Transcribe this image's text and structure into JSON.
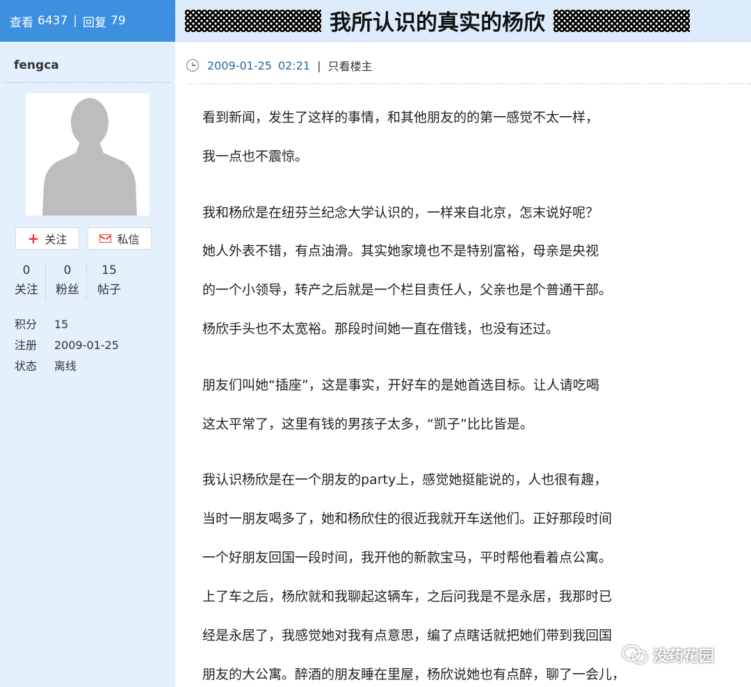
{
  "header": {
    "views_label": "查看",
    "views_count": "6437",
    "separator": "|",
    "replies_label": "回复",
    "replies_count": "79",
    "title": "我所认识的真实的杨欣"
  },
  "user": {
    "name": "fengca",
    "follow_label": "关注",
    "message_label": "私信",
    "stats": [
      {
        "value": "0",
        "label": "关注"
      },
      {
        "value": "0",
        "label": "粉丝"
      },
      {
        "value": "15",
        "label": "帖子"
      }
    ],
    "info": [
      {
        "key": "积分",
        "value": "15"
      },
      {
        "key": "注册",
        "value": "2009-01-25"
      },
      {
        "key": "状态",
        "value": "离线"
      }
    ]
  },
  "post": {
    "date": "2009-01-25",
    "time": "02:21",
    "separator": "|",
    "author_only_label": "只看楼主",
    "lines": [
      "看到新闻，发生了这样的事情，和其他朋友的的第一感觉不太一样，",
      "我一点也不震惊。",
      "我和杨欣是在纽芬兰纪念大学认识的，一样来自北京，怎末说好呢？",
      "她人外表不错，有点油滑。其实她家境也不是特别富裕，母亲是央视",
      "的一个小领导，转产之后就是一个栏目责任人，父亲也是个普通干部。",
      "杨欣手头也不太宽裕。那段时间她一直在借钱，也没有还过。",
      "朋友们叫她“插座”，这是事实，开好车的是她首选目标。让人请吃喝",
      "这太平常了，这里有钱的男孩子太多，“凯子”比比皆是。",
      "我认识杨欣是在一个朋友的party上，感觉她挺能说的，人也很有趣，",
      "当时一朋友喝多了，她和杨欣住的很近我就开车送他们。正好那段时间",
      "一个好朋友回国一段时间，我开他的新款宝马，平时帮他看着点公寓。",
      "上了车之后，杨欣就和我聊起这辆车，之后问我是不是永居，我那时已",
      "经是永居了，我感觉她对我有点意思，编了点瞎话就把她们带到我回国",
      "朋友的大公寓。醉酒的朋友睡在里屋，杨欣说她也有点醉，聊了一会儿，"
    ]
  },
  "watermark": {
    "text": "没药花园",
    "icon": "wechat-icon"
  },
  "colors": {
    "stats_bar": "#3d8fe0",
    "title_bar": "#dcebfa",
    "sidebar": "#e4f0fc",
    "date_link": "#26689e",
    "accent_red": "#e33333"
  }
}
